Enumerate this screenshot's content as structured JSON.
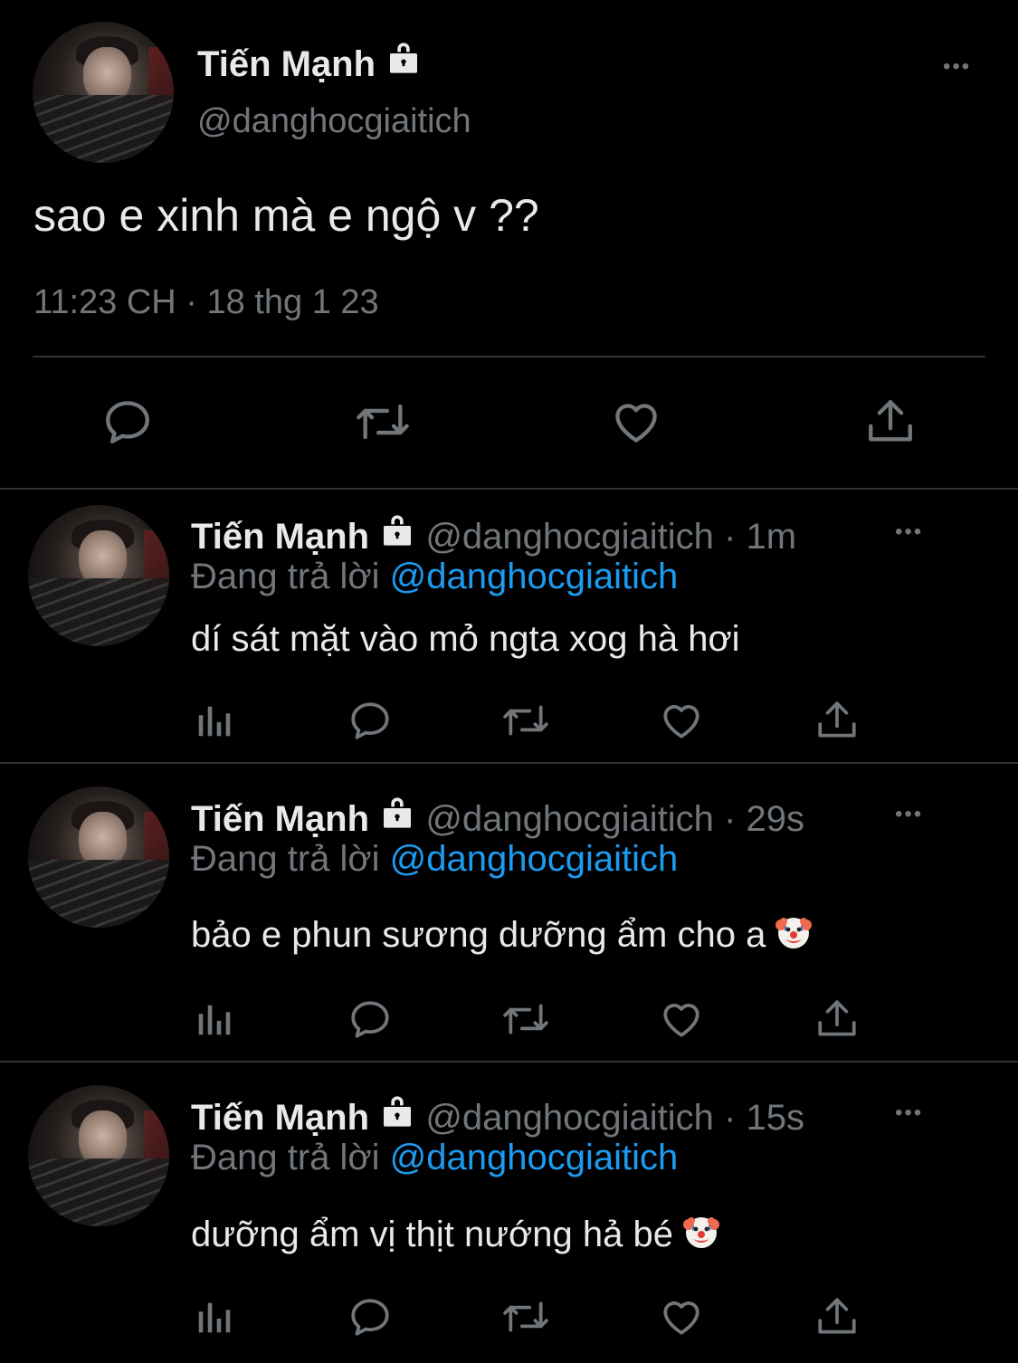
{
  "main_tweet": {
    "display_name": "Tiến Mạnh",
    "handle": "@danghocgiaitich",
    "text": "sao e xinh mà e ngộ v ??",
    "timestamp": "11:23 CH · 18 thg 1 23",
    "more_label": "•••",
    "actions": [
      "reply-icon",
      "retweet-icon",
      "like-icon",
      "share-icon"
    ]
  },
  "replies": [
    {
      "display_name": "Tiến Mạnh",
      "handle": "@danghocgiaitich",
      "time": "· 1m",
      "replying_prefix": "Đang trả lời",
      "replying_to": "@danghocgiaitich",
      "text": "dí sát mặt vào mỏ ngta xog hà hơi",
      "emoji": "",
      "more_label": "•••"
    },
    {
      "display_name": "Tiến Mạnh",
      "handle": "@danghocgiaitich",
      "time": "· 29s",
      "replying_prefix": "Đang trả lời",
      "replying_to": "@danghocgiaitich",
      "text": "bảo e phun sương dưỡng ẩm cho a",
      "emoji": "clown-face",
      "more_label": "•••"
    },
    {
      "display_name": "Tiến Mạnh",
      "handle": "@danghocgiaitich",
      "time": "· 15s",
      "replying_prefix": "Đang trả lời",
      "replying_to": "@danghocgiaitich",
      "text": "dưỡng ẩm vị thịt nướng hả bé",
      "emoji": "clown-face",
      "more_label": "•••"
    }
  ],
  "reply_actions": [
    "analytics-icon",
    "reply-icon",
    "retweet-icon",
    "like-icon",
    "share-icon"
  ],
  "colors": {
    "background": "#000000",
    "text": "#e7e9ea",
    "muted": "#71767b",
    "link": "#1d9bf0",
    "divider": "#2f3336"
  }
}
